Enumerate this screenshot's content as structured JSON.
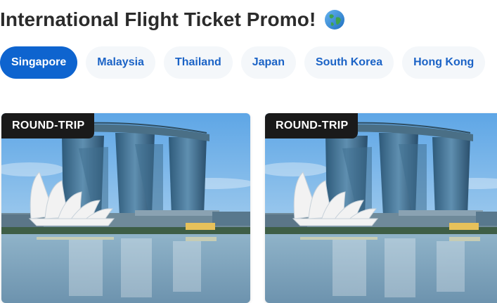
{
  "header": {
    "title": "International Flight Ticket Promo!",
    "title_icon": "globe-icon"
  },
  "tabs": [
    {
      "label": "Singapore",
      "active": true
    },
    {
      "label": "Malaysia",
      "active": false
    },
    {
      "label": "Thailand",
      "active": false
    },
    {
      "label": "Japan",
      "active": false
    },
    {
      "label": "South Korea",
      "active": false
    },
    {
      "label": "Hong Kong",
      "active": false
    }
  ],
  "cards": [
    {
      "badge": "ROUND-TRIP",
      "image": "singapore-marina-bay-photo"
    },
    {
      "badge": "ROUND-TRIP",
      "image": "singapore-marina-bay-photo"
    }
  ],
  "colors": {
    "accent": "#0e64cf",
    "pill_text": "#1b63c6",
    "pill_bg": "#f4f7fa",
    "badge_bg": "#1a1a1a",
    "title": "#2b2b2b"
  }
}
